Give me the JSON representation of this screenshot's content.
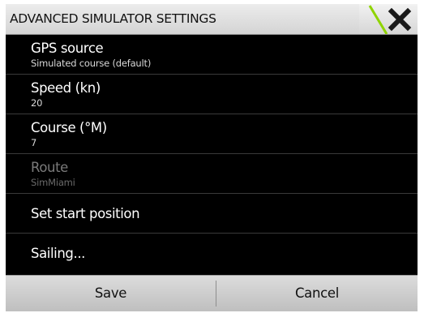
{
  "dialog": {
    "title": "ADVANCED SIMULATOR SETTINGS",
    "close_icon": "close-x-icon",
    "accent_color": "#8fd400"
  },
  "items": [
    {
      "label": "GPS source",
      "value": "Simulated course (default)",
      "enabled": true
    },
    {
      "label": "Speed (kn)",
      "value": "20",
      "enabled": true
    },
    {
      "label": "Course (°M)",
      "value": "7",
      "enabled": true
    },
    {
      "label": "Route",
      "value": "SimMiami",
      "enabled": false
    },
    {
      "label": "Set start position",
      "enabled": true
    },
    {
      "label": "Sailing...",
      "enabled": true
    }
  ],
  "footer": {
    "save_label": "Save",
    "cancel_label": "Cancel"
  }
}
